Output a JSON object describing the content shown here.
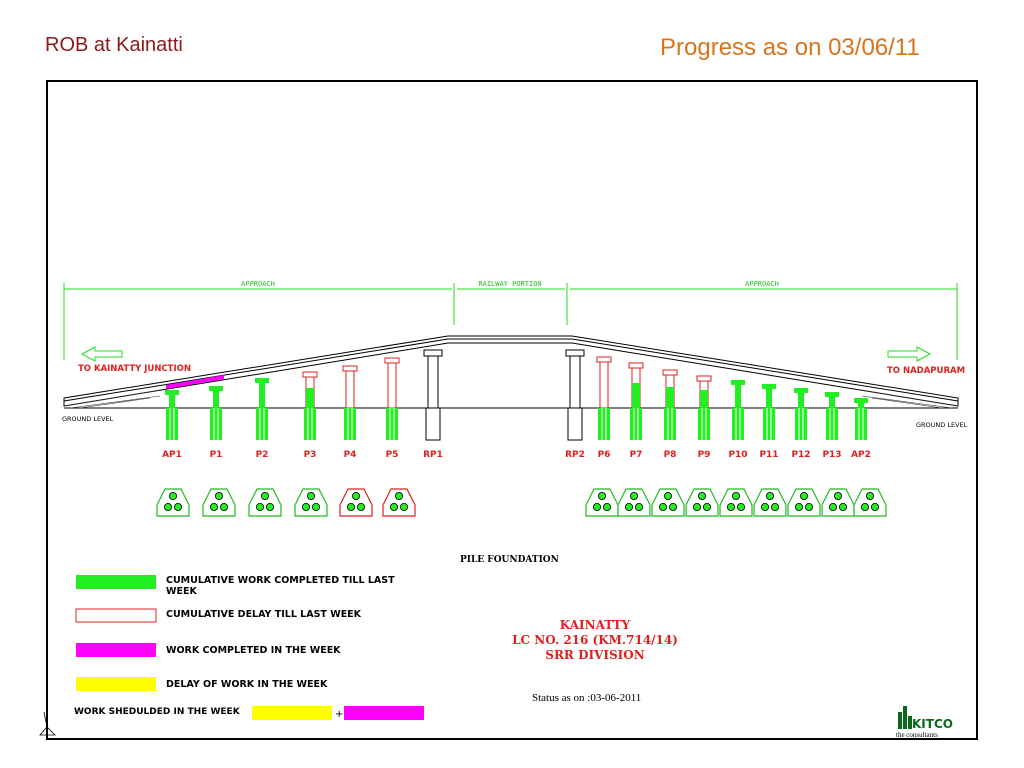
{
  "header": {
    "title": "ROB at Kainatti",
    "progress": "Progress as on 03/06/11"
  },
  "drawing": {
    "approach_left": "APPROACH",
    "railway_portion": "RAILWAY PORTION",
    "approach_right": "APPROACH",
    "to_left": "TO KAINATTY JUNCTION",
    "to_right": "TO NADAPURAM",
    "ground_left": "GROUND LEVEL",
    "ground_right": "GROUND LEVEL",
    "pile_foundation": "PILE FOUNDATION"
  },
  "piers": [
    "AP1",
    "P1",
    "P2",
    "P3",
    "P4",
    "P5",
    "RP1",
    "RP2",
    "P6",
    "P7",
    "P8",
    "P9",
    "P10",
    "P11",
    "P12",
    "P13",
    "AP2"
  ],
  "legend": {
    "completed": "CUMULATIVE WORK COMPLETED TILL LAST WEEK",
    "delay": "CUMULATIVE DELAY TILL LAST WEEK",
    "week_done": "WORK COMPLETED IN THE WEEK",
    "week_delay": "DELAY OF WORK IN THE WEEK",
    "scheduled": "WORK SHEDULDED IN THE WEEK",
    "plus": "+"
  },
  "project": {
    "line1": "KAINATTY",
    "line2": "LC NO. 216 (KM.714/14)",
    "line3": "SRR DIVISION"
  },
  "status": "Status as on  :03-06-2011",
  "logo": {
    "name": "KITCO",
    "tagline": "the consultants"
  },
  "colors": {
    "completed": "#22ee22",
    "delay": "#e0201e",
    "week_done": "#ff00ff",
    "week_delay": "#ffff00"
  }
}
